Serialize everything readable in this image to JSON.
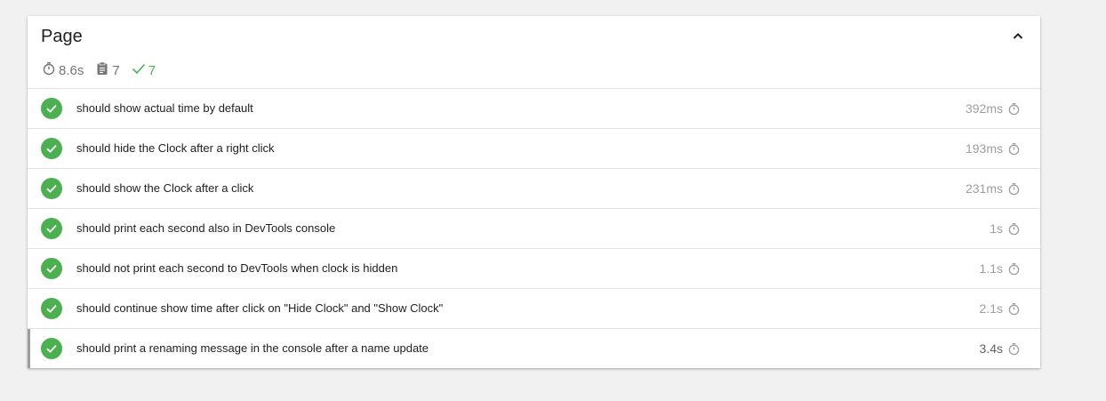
{
  "suite": {
    "title": "Page",
    "duration": "8.6s",
    "total_tests": "7",
    "passed_tests": "7"
  },
  "icons": {
    "collapse": "chevron-up-icon",
    "duration": "stopwatch-icon",
    "tests": "clipboard-icon",
    "passed": "check-icon",
    "test_status": "check-circle-icon"
  },
  "colors": {
    "passed": "#4caf50",
    "muted": "#9e9e9e"
  },
  "tests": [
    {
      "title": "should show actual time by default",
      "duration": "392ms"
    },
    {
      "title": "should hide the Clock after a right click",
      "duration": "193ms"
    },
    {
      "title": "should show the Clock after a click",
      "duration": "231ms"
    },
    {
      "title": "should print each second also in DevTools console",
      "duration": "1s"
    },
    {
      "title": "should not print each second to DevTools when clock is hidden",
      "duration": "1.1s"
    },
    {
      "title": "should continue show time after click on \"Hide Clock\" and \"Show Clock\"",
      "duration": "2.1s"
    },
    {
      "title": "should print a renaming message in the console after a name update",
      "duration": "3.4s"
    }
  ]
}
